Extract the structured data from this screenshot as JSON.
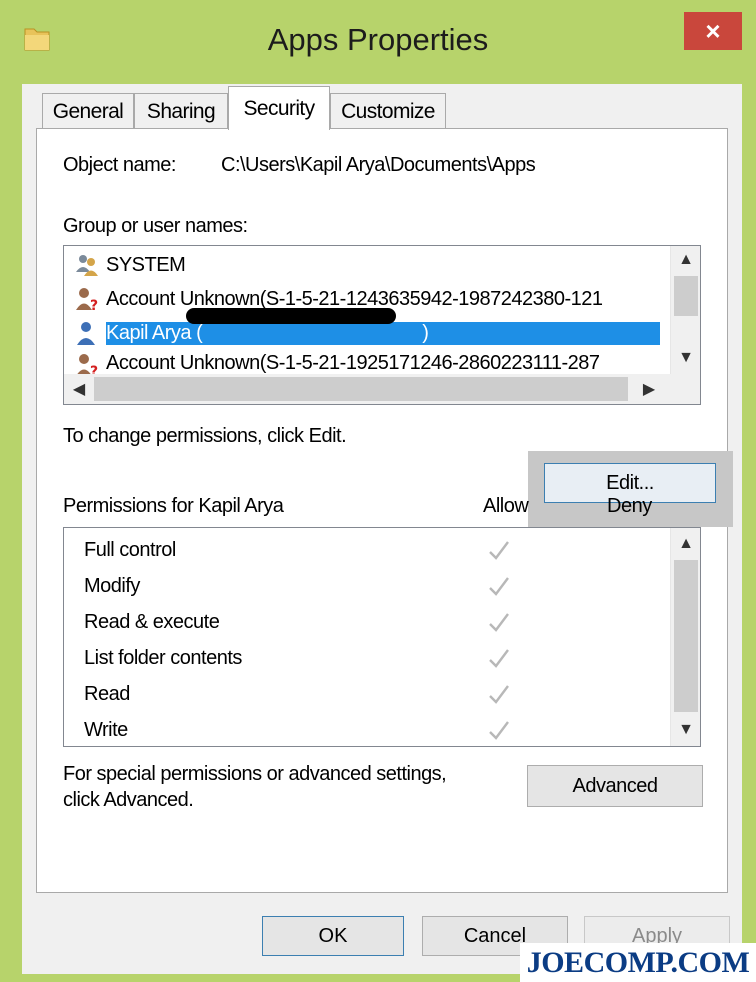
{
  "window": {
    "title": "Apps Properties",
    "close_glyph": "×"
  },
  "tabs": [
    {
      "label": "General",
      "active": false
    },
    {
      "label": "Sharing",
      "active": false
    },
    {
      "label": "Security",
      "active": true
    },
    {
      "label": "Customize",
      "active": false
    }
  ],
  "security": {
    "object_name_label": "Object name:",
    "object_name_value": "C:\\Users\\Kapil Arya\\Documents\\Apps",
    "group_label": "Group or user names:",
    "users": [
      {
        "name": "SYSTEM",
        "icon": "system-users-icon",
        "selected": false
      },
      {
        "name": "Account Unknown(S-1-5-21-1243635942-1987242380-121",
        "icon": "unknown-account-icon",
        "selected": false
      },
      {
        "name": "Kapil Arya",
        "name_suffix": "(",
        "name_end": ")",
        "icon": "user-icon",
        "selected": true
      },
      {
        "name": "Account Unknown(S-1-5-21-1925171246-2860223111-287",
        "icon": "unknown-account-icon",
        "selected": false
      }
    ],
    "change_text": "To change permissions, click Edit.",
    "edit_label": "Edit...",
    "permissions_label": "Permissions for Kapil Arya",
    "allow_header": "Allow",
    "deny_header": "Deny",
    "permissions": [
      {
        "name": "Full control",
        "allow": true,
        "deny": false
      },
      {
        "name": "Modify",
        "allow": true,
        "deny": false
      },
      {
        "name": "Read & execute",
        "allow": true,
        "deny": false
      },
      {
        "name": "List folder contents",
        "allow": true,
        "deny": false
      },
      {
        "name": "Read",
        "allow": true,
        "deny": false
      },
      {
        "name": "Write",
        "allow": true,
        "deny": false
      }
    ],
    "special_text_1": "For special permissions or advanced settings,",
    "special_text_2": "click Advanced.",
    "advanced_label": "Advanced"
  },
  "buttons": {
    "ok": "OK",
    "cancel": "Cancel",
    "apply": "Apply"
  },
  "watermark": "JOECOMP.COM",
  "colors": {
    "frame": "#b7d36b",
    "selection": "#1e8fe6",
    "close": "#c9473c",
    "watermark": "#0b3c84"
  }
}
